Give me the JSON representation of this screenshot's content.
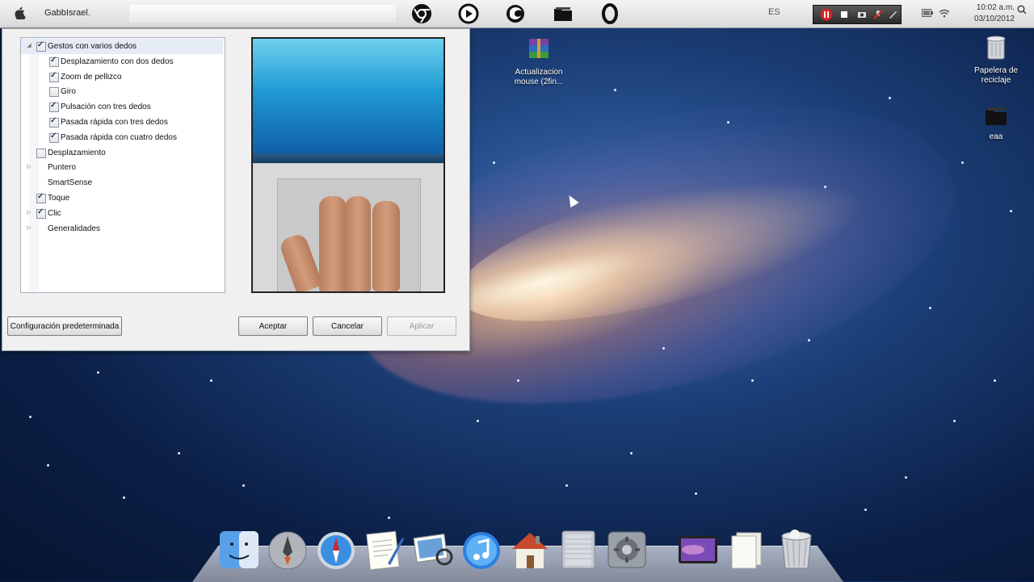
{
  "menubar": {
    "user_name": "GabbIsrael.",
    "language": "ES",
    "time": "10:02 a.m.",
    "date": "03/10/2012",
    "icons": [
      "apple-icon",
      "chrome-icon",
      "media-player-icon",
      "firefox-icon",
      "folder-icon",
      "opera-icon",
      "recorder-toolbar",
      "battery-icon",
      "wifi-icon",
      "search-icon"
    ]
  },
  "dialog": {
    "tree": [
      {
        "label": "Gestos con varios dedos",
        "checked": true,
        "level": 0,
        "expander": "open"
      },
      {
        "label": "Desplazamiento con dos dedos",
        "checked": true,
        "level": 1
      },
      {
        "label": "Zoom de pellizco",
        "checked": true,
        "level": 1
      },
      {
        "label": "Giro",
        "checked": false,
        "level": 1
      },
      {
        "label": "Pulsación con tres dedos",
        "checked": true,
        "level": 1
      },
      {
        "label": "Pasada rápida con tres dedos",
        "checked": true,
        "level": 1
      },
      {
        "label": "Pasada rápida con cuatro dedos",
        "checked": true,
        "level": 1
      },
      {
        "label": "Desplazamiento",
        "checked": false,
        "level": 0
      },
      {
        "label": "Puntero",
        "checked": null,
        "level": 0,
        "expander": "closed"
      },
      {
        "label": "SmartSense",
        "checked": null,
        "level": 0
      },
      {
        "label": "Toque",
        "checked": true,
        "level": 0
      },
      {
        "label": "Clic",
        "checked": true,
        "level": 0,
        "expander": "closed"
      },
      {
        "label": "Generalidades",
        "checked": null,
        "level": 0,
        "expander": "closed"
      }
    ],
    "buttons": {
      "defaults": "Configuración predeterminada",
      "accept": "Aceptar",
      "cancel": "Cancelar",
      "apply": "Aplicar"
    }
  },
  "desktop_icons": [
    {
      "label_line1": "Actualizacion",
      "label_line2": "mouse (2fin...",
      "icon": "winrar-archive-icon"
    },
    {
      "label_line1": "Papelera de",
      "label_line2": "reciclaje",
      "icon": "recycle-bin-icon"
    },
    {
      "label_line1": "eaa",
      "label_line2": "",
      "icon": "folder-icon"
    }
  ],
  "dock": [
    "finder-icon",
    "launchpad-icon",
    "safari-icon",
    "textedit-icon",
    "iphoto-icon",
    "itunes-icon",
    "home-icon",
    "mac-pro-icon",
    "system-preferences-icon",
    "photo-booth-icon",
    "document-icon",
    "trash-icon"
  ]
}
